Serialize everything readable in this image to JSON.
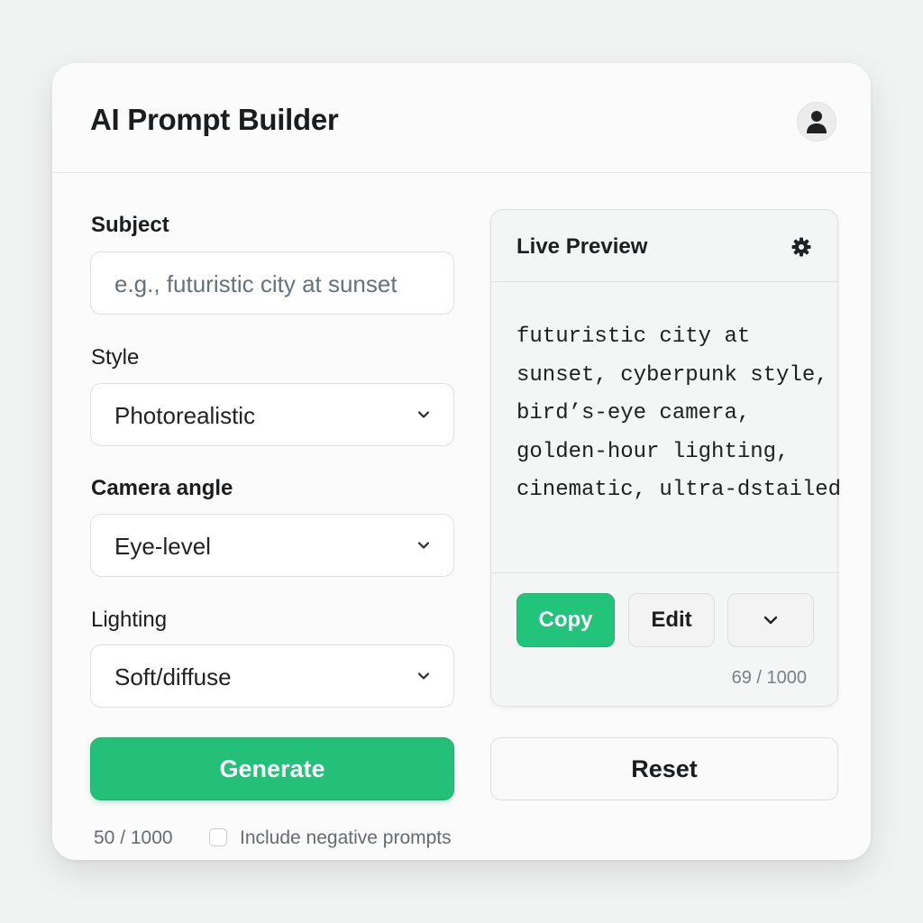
{
  "app": {
    "title": "AI Prompt Builder",
    "avatar_icon": "user-icon"
  },
  "form": {
    "subject": {
      "label": "Subject",
      "placeholder": "e.g., futuristic city at sunset",
      "value": ""
    },
    "style": {
      "label": "Style",
      "selected": "Photorealistic"
    },
    "camera_angle": {
      "label": "Camera angle",
      "selected": "Eye-level"
    },
    "lighting": {
      "label": "Lighting",
      "selected": "Soft/diffuse"
    },
    "generate_label": "Generate",
    "reset_label": "Reset",
    "char_count": "50 / 1000",
    "negative_prompts_label": "Include negative prompts",
    "negative_prompts_checked": false
  },
  "preview": {
    "title": "Live Preview",
    "settings_icon": "gear-icon",
    "lines": [
      "futuristic city at",
      "sunset, cyberpunk style,",
      "bird’s-eye camera,",
      "golden-hour lighting,",
      "cinematic, ultra-dstailed"
    ],
    "copy_label": "Copy",
    "edit_label": "Edit",
    "more_icon": "chevron-down-icon",
    "char_count": "69 / 1000"
  },
  "colors": {
    "accent": "#22c37b",
    "background": "#f1f2f2",
    "card": "#fbfbfb",
    "text": "#1b1c1d",
    "muted": "#656b70"
  }
}
